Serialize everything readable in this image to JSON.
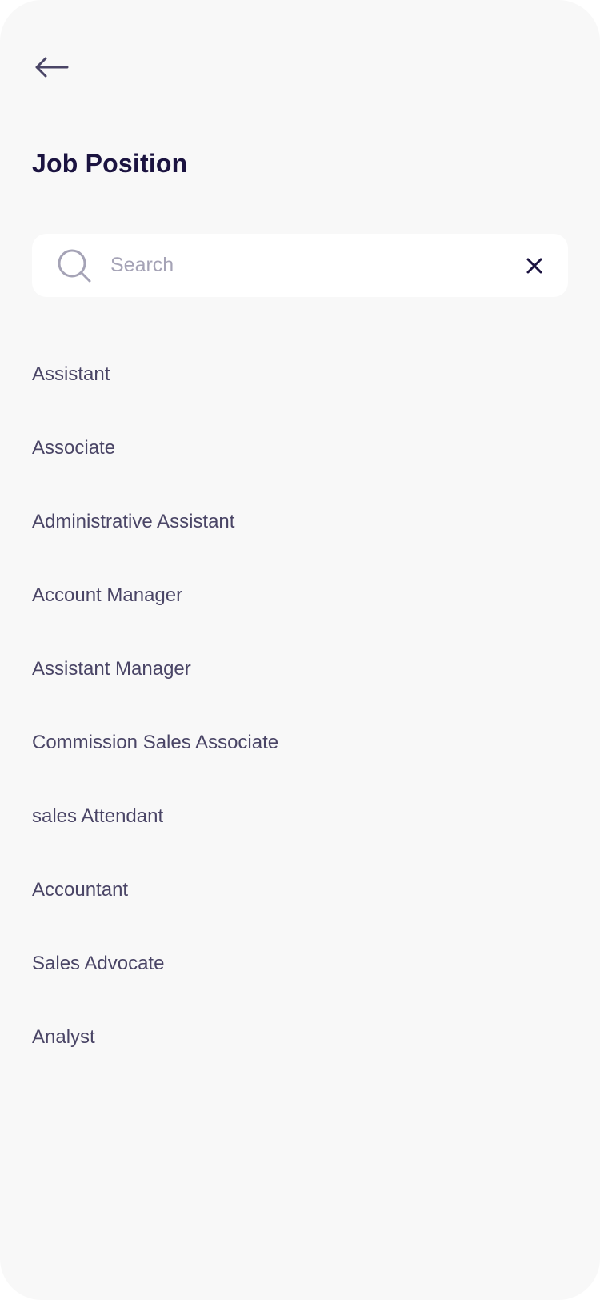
{
  "header": {
    "back_icon": "arrow-left-icon",
    "title": "Job Position"
  },
  "search": {
    "icon": "search-icon",
    "placeholder": "Search",
    "value": "",
    "clear_icon": "close-icon"
  },
  "colors": {
    "background": "#f8f8f8",
    "title": "#1b1340",
    "list_text": "#4a4566",
    "placeholder": "#a5a3b6",
    "search_bg": "#ffffff"
  },
  "positions": [
    {
      "label": "Assistant"
    },
    {
      "label": "Associate"
    },
    {
      "label": "Administrative Assistant"
    },
    {
      "label": "Account Manager"
    },
    {
      "label": "Assistant Manager"
    },
    {
      "label": "Commission Sales Associate"
    },
    {
      "label": "sales Attendant"
    },
    {
      "label": "Accountant"
    },
    {
      "label": "Sales Advocate"
    },
    {
      "label": "Analyst"
    }
  ]
}
